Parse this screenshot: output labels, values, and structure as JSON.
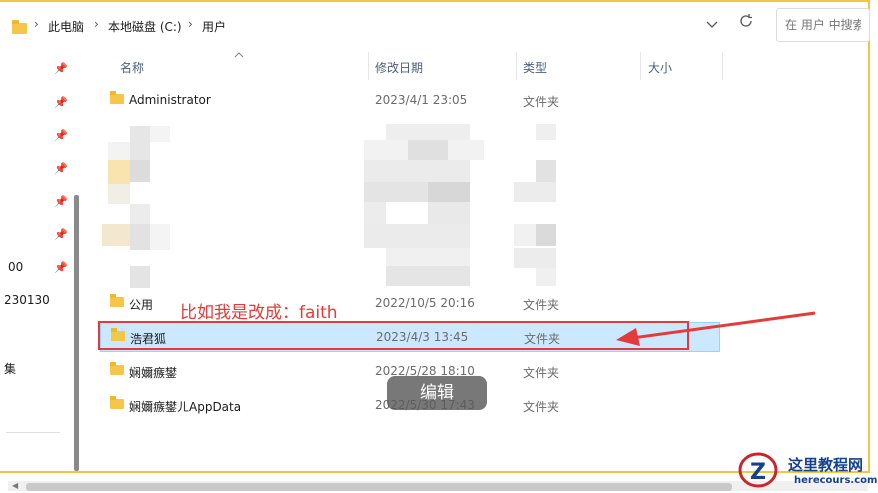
{
  "address": {
    "crumbs": [
      "此电脑",
      "本地磁盘 (C:)",
      "用户"
    ],
    "separator": "›",
    "chevron": "chevron-down-icon",
    "refresh": "refresh-icon"
  },
  "search": {
    "placeholder": "在 用户 中搜索"
  },
  "nav": {
    "partial_labels": [
      "00",
      "230130",
      "集"
    ]
  },
  "columns": {
    "name": "名称",
    "date": "修改日期",
    "type": "类型",
    "size": "大小"
  },
  "rows": [
    {
      "name": "Administrator",
      "date": "2023/4/1 23:05",
      "type": "文件夹"
    },
    {
      "name": "公用",
      "date": "2022/10/5 20:16",
      "type": "文件夹"
    },
    {
      "name": "浩君狐",
      "date": "2023/4/3 13:45",
      "type": "文件夹"
    },
    {
      "name": "娴嬭瘯鐢",
      "date": "2022/5/28 18:10",
      "type": "文件夹"
    },
    {
      "name": "娴嬭瘯鐢ㄦAppData",
      "date": "2022/5/30 17:43",
      "type": "文件夹"
    }
  ],
  "annotation": {
    "text": "比如我是改成：faith",
    "color": "#e33b3b"
  },
  "toast": {
    "label": "编辑"
  },
  "watermark": {
    "title": "这里教程网",
    "url": "herecours.com"
  },
  "colors": {
    "selection": "#cce8ff",
    "folder": "#f5c64a",
    "frame": "#f4c542"
  }
}
